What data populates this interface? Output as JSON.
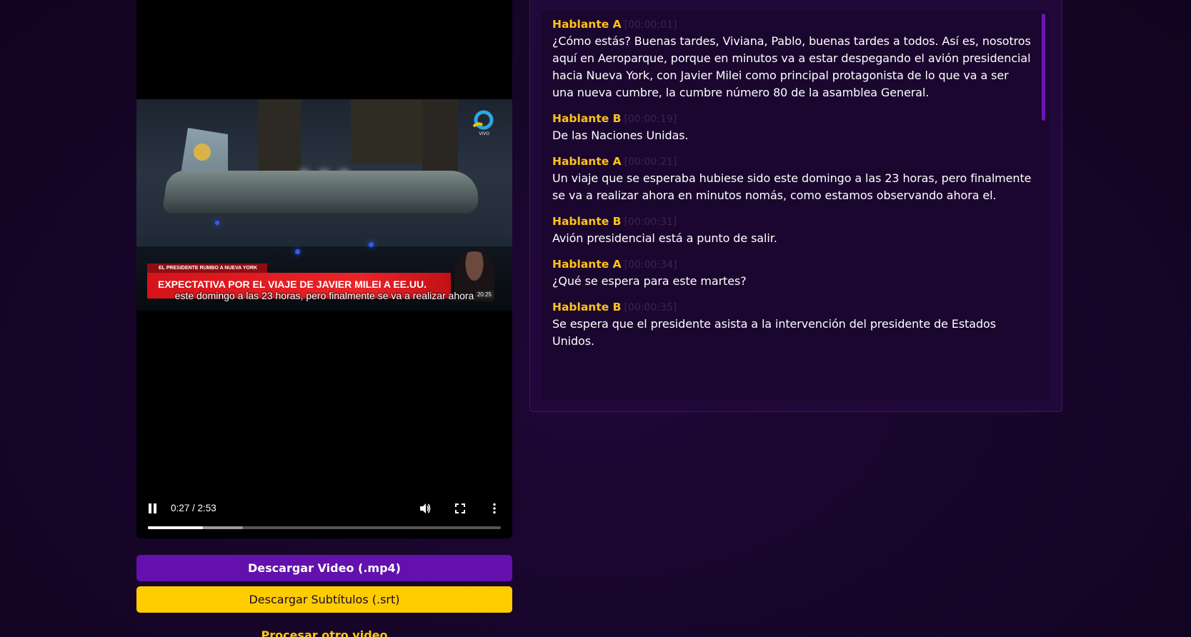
{
  "video": {
    "channel_badge": "VIVO",
    "lower_third_kicker": "EL PRESIDENTE RUMBO A NUEVA YORK",
    "lower_third_headline": "EXPECTATIVA POR EL VIAJE DE JAVIER MILEI A EE.UU.",
    "broadcast_time": "20:25",
    "caption": "este domingo a las 23 horas, pero finalmente se va a realizar ahora",
    "time_display": "0:27 / 2:53",
    "progress_played": 0.156,
    "progress_buffered": 0.27,
    "icons": [
      "pause-icon",
      "volume-icon",
      "fullscreen-icon",
      "more-options-icon"
    ]
  },
  "actions": {
    "download_video": "Descargar Video (.mp4)",
    "download_subtitles": "Descargar Subtítulos (.srt)",
    "process_other": "Procesar otro video"
  },
  "colors": {
    "accent_purple": "#6310ad",
    "accent_yellow": "#ffcc00",
    "speaker_color": "#ffc31a"
  },
  "transcript": [
    {
      "speaker": "Hablante A",
      "time": "[00:00:01]",
      "text": "¿Cómo estás? Buenas tardes, Viviana, Pablo, buenas tardes a todos. Así es, nosotros aquí en Aeroparque, porque en minutos va a estar despegando el avión presidencial hacia Nueva York, con Javier Milei como principal protagonista de lo que va a ser una nueva cumbre, la cumbre número 80 de la asamblea General."
    },
    {
      "speaker": "Hablante B",
      "time": "[00:00:19]",
      "text": "De las Naciones Unidas."
    },
    {
      "speaker": "Hablante A",
      "time": "[00:00:21]",
      "text": "Un viaje que se esperaba hubiese sido este domingo a las 23 horas, pero finalmente se va a realizar ahora en minutos nomás, como estamos observando ahora el."
    },
    {
      "speaker": "Hablante B",
      "time": "[00:00:31]",
      "text": "Avión presidencial está a punto de salir."
    },
    {
      "speaker": "Hablante A",
      "time": "[00:00:34]",
      "text": "¿Qué se espera para este martes?"
    },
    {
      "speaker": "Hablante B",
      "time": "[00:00:35]",
      "text": "Se espera que el presidente asista a la intervención del presidente de Estados Unidos."
    }
  ]
}
